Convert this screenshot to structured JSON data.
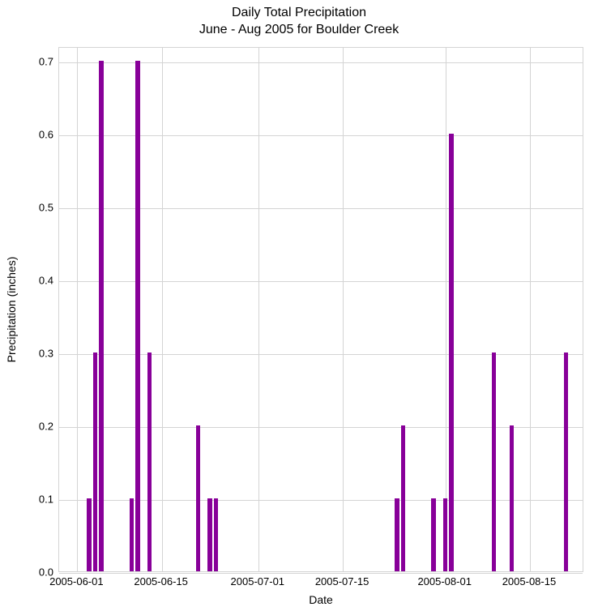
{
  "chart_data": {
    "type": "bar",
    "title": "Daily Total Precipitation",
    "subtitle": "June - Aug 2005 for Boulder Creek",
    "xlabel": "Date",
    "ylabel": "Precipitation (inches)",
    "ylim": [
      0.0,
      0.72
    ],
    "xlim": [
      "2005-05-29",
      "2005-08-24"
    ],
    "xticks": [
      "2005-06-01",
      "2005-06-15",
      "2005-07-01",
      "2005-07-15",
      "2005-08-01",
      "2005-08-15"
    ],
    "yticks": [
      0.0,
      0.1,
      0.2,
      0.3,
      0.4,
      0.5,
      0.6,
      0.7
    ],
    "bar_color": "#880099",
    "categories": [
      "2005-06-01",
      "2005-06-02",
      "2005-06-03",
      "2005-06-04",
      "2005-06-05",
      "2005-06-06",
      "2005-06-07",
      "2005-06-08",
      "2005-06-09",
      "2005-06-10",
      "2005-06-11",
      "2005-06-12",
      "2005-06-13",
      "2005-06-14",
      "2005-06-15",
      "2005-06-16",
      "2005-06-17",
      "2005-06-18",
      "2005-06-19",
      "2005-06-20",
      "2005-06-21",
      "2005-06-22",
      "2005-06-23",
      "2005-06-24",
      "2005-06-25",
      "2005-06-26",
      "2005-06-27",
      "2005-06-28",
      "2005-06-29",
      "2005-06-30",
      "2005-07-01",
      "2005-07-02",
      "2005-07-03",
      "2005-07-04",
      "2005-07-05",
      "2005-07-06",
      "2005-07-07",
      "2005-07-08",
      "2005-07-09",
      "2005-07-10",
      "2005-07-11",
      "2005-07-12",
      "2005-07-13",
      "2005-07-14",
      "2005-07-15",
      "2005-07-16",
      "2005-07-17",
      "2005-07-18",
      "2005-07-19",
      "2005-07-20",
      "2005-07-21",
      "2005-07-22",
      "2005-07-23",
      "2005-07-24",
      "2005-07-25",
      "2005-07-26",
      "2005-07-27",
      "2005-07-28",
      "2005-07-29",
      "2005-07-30",
      "2005-07-31",
      "2005-08-01",
      "2005-08-02",
      "2005-08-03",
      "2005-08-04",
      "2005-08-05",
      "2005-08-06",
      "2005-08-07",
      "2005-08-08",
      "2005-08-09",
      "2005-08-10",
      "2005-08-11",
      "2005-08-12",
      "2005-08-13",
      "2005-08-14",
      "2005-08-15",
      "2005-08-16",
      "2005-08-17",
      "2005-08-18",
      "2005-08-19",
      "2005-08-20",
      "2005-08-21",
      "2005-08-22",
      "2005-08-23"
    ],
    "values": [
      0,
      0,
      0.1,
      0.3,
      0.7,
      0,
      0,
      0,
      0,
      0.1,
      0.7,
      0,
      0.3,
      0,
      0,
      0,
      0,
      0,
      0,
      0,
      0.2,
      0,
      0.1,
      0.1,
      0,
      0,
      0,
      0,
      0,
      0,
      0,
      0,
      0,
      0,
      0,
      0,
      0,
      0,
      0,
      0,
      0,
      0,
      0,
      0,
      0,
      0,
      0,
      0,
      0,
      0,
      0,
      0,
      0,
      0.1,
      0.2,
      0,
      0,
      0,
      0,
      0.1,
      0,
      0.1,
      0.6,
      0,
      0,
      0,
      0,
      0,
      0,
      0.3,
      0,
      0,
      0.2,
      0,
      0,
      0,
      0,
      0,
      0,
      0,
      0,
      0.3,
      0,
      0
    ]
  }
}
